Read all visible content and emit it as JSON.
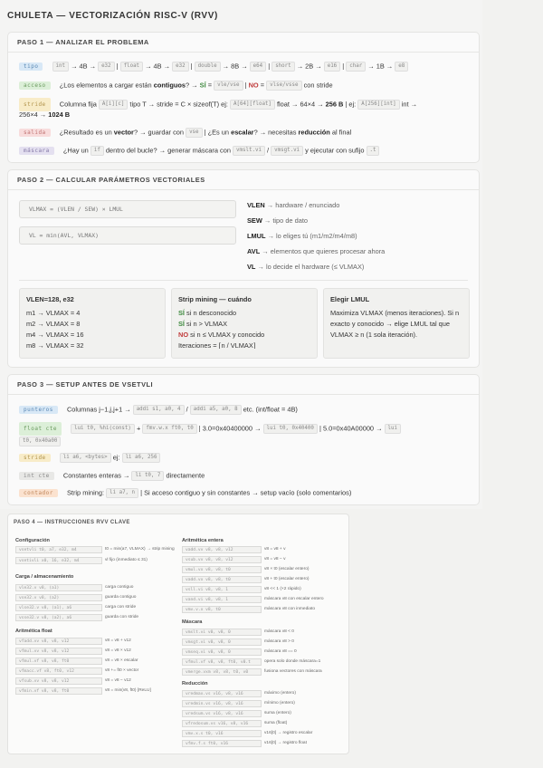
{
  "title": "CHULETA — VECTORIZACIÓN RISC-V (RVV)",
  "paso1": {
    "header": "PASO 1 — ANALIZAR EL PROBLEMA",
    "tipo_tag": "tipo",
    "tipo": {
      "c1": "int",
      "t1": "→ 4B →",
      "c2": "e32",
      "sep1": "|",
      "c3": "float",
      "t2": "→ 4B →",
      "c4": "e32",
      "sep2": "|",
      "c5": "double",
      "t3": "→ 8B →",
      "c6": "e64",
      "sep3": "|",
      "c7": "short",
      "t4": "→ 2B →",
      "c8": "e16",
      "sep4": "|",
      "c9": "char",
      "t5": "→ 1B →",
      "c10": "e8"
    },
    "acceso_tag": "acceso",
    "acceso": {
      "q": "¿Los elementos a cargar están",
      "b1": "contiguos",
      "q2": "? →",
      "si": "SÍ",
      "eq1": "=",
      "c1": "vle/vse",
      "sep": "|",
      "no": "NO",
      "eq2": "=",
      "c2": "vlse/vsse",
      "tail": "con stride"
    },
    "stride_tag": "stride",
    "stride": {
      "t1": "Columna fija",
      "c1": "A[i][c]",
      "t2": "tipo T → stride = C × sizeof(T)   ej:",
      "c2": "A[64][float]",
      "t3": "float → 64×4 →",
      "b1": "256 B",
      "sep": "|",
      "t4": "ej:",
      "c3": "A[256][int]",
      "t5": "int →",
      "line2": "256×4 →",
      "b2": "1024 B"
    },
    "salida_tag": "salida",
    "salida": {
      "t1": "¿Resultado es un",
      "b1": "vector",
      "t2": "? → guardar con",
      "c1": "vse",
      "sep": "|",
      "t3": "¿Es un",
      "b2": "escalar",
      "t4": "? → necesitas",
      "b3": "reducción",
      "t5": "al final"
    },
    "mascara_tag": "máscara",
    "mascara": {
      "t1": "¿Hay un",
      "c1": "if",
      "t2": "dentro del bucle? → generar máscara con",
      "c2": "vmslt.vi",
      "t3": "/",
      "c3": "vmsgt.vi",
      "t4": "y ejecutar con sufijo",
      "c4": ".t"
    }
  },
  "paso2": {
    "header": "PASO 2 — CALCULAR PARÁMETROS VECTORIALES",
    "f1": "VLMAX = (VLEN / SEW) × LMUL",
    "f2": "VL = min(AVL, VLMAX)",
    "defs": [
      {
        "k": "VLEN",
        "v": "→ hardware / enunciado"
      },
      {
        "k": "SEW",
        "v": "→ tipo de dato"
      },
      {
        "k": "LMUL",
        "v": "→ lo eliges tú (m1/m2/m4/m8)"
      },
      {
        "k": "AVL",
        "v": "→ elementos que quieres procesar ahora"
      },
      {
        "k": "VL",
        "v": "→ lo decide el hardware (≤ VLMAX)"
      }
    ],
    "box1": {
      "h": "VLEN=128, e32",
      "lines": [
        "m1 → VLMAX = 4",
        "m2 → VLMAX = 8",
        "m4 → VLMAX = 16",
        "m8 → VLMAX = 32"
      ]
    },
    "box2": {
      "h": "Strip mining — cuándo",
      "l1a": "SÍ",
      "l1b": "si n desconocido",
      "l2a": "SÍ",
      "l2b": "si n > VLMAX",
      "l3a": "NO",
      "l3b": "si n ≤ VLMAX y conocido",
      "l4": "Iteraciones = ⌈n / VLMAX⌉"
    },
    "box3": {
      "h": "Elegir LMUL",
      "text": "Maximiza VLMAX (menos iteraciones). Si n exacto y conocido → elige LMUL tal que VLMAX ≥ n (1 sola iteración)."
    }
  },
  "paso3": {
    "header": "PASO 3 — SETUP ANTES DE VSETVLI",
    "punteros_tag": "punteros",
    "punteros": {
      "t1": "Columnas j−1,j,j+1 →",
      "c1": "addi s1, a0, 4",
      "t2": "/",
      "c2": "addi a5, a0, 8",
      "t3": "etc. (int/float = 4B)"
    },
    "floats_tag": "float cte",
    "floats": {
      "c1": "lui t0, %hi(const)",
      "t1": "+",
      "c2": "fmv.w.x ft0, t0",
      "t2": "| 3.0=0x40400000 →",
      "c3": "lui t0, 0x40400",
      "t3": "| 5.0=0x40A00000 →",
      "c4": "lui",
      "c5": "t0, 0x40a00"
    },
    "stride_tag": "stride",
    "stride": {
      "c1": "li a6, <bytes>",
      "t1": "ej:",
      "c2": "li a6, 256"
    },
    "int_tag": "int cte",
    "int": {
      "t1": "Constantes enteras →",
      "c1": "li t0, 7",
      "t2": "directamente"
    },
    "contador_tag": "contador",
    "contador": {
      "t1": "Strip mining:",
      "c1": "li a7, n",
      "t2": "| Si acceso contiguo y sin constantes → setup vacío (solo comentarios)"
    }
  },
  "paso4": {
    "header": "PASO 4 — INSTRUCCIONES RVV CLAVE",
    "config_h": "Configuración",
    "config": [
      {
        "c": "vsetvli t0, a7, e32, m4",
        "d": "t0 = min(a7, VLMAX) → strip mining"
      },
      {
        "c": "vsetivli x0, 16, e32, m4",
        "d": "vl fijo (inmediato ≤ 31)"
      }
    ],
    "carga_h": "Carga / almacenamiento",
    "carga": [
      {
        "c": "vle32.v v8, (a1)",
        "d": "carga contiguo"
      },
      {
        "c": "vse32.v v8, (a2)",
        "d": "guarda contiguo"
      },
      {
        "c": "vlse32.v v8, (a1), a6",
        "d": "carga con stride"
      },
      {
        "c": "vsse32.v v8, (a2), a6",
        "d": "guarda con stride"
      }
    ],
    "afloat_h": "Aritmética float",
    "afloat": [
      {
        "c": "vfadd.vv v8, v8, v12",
        "d": "v8 = v8 + v12"
      },
      {
        "c": "vfmul.vv v8, v8, v12",
        "d": "v8 = v8 × v12"
      },
      {
        "c": "vfmul.vf v8, v8, ft0",
        "d": "v8 = v8 × escalar"
      },
      {
        "c": "vfmacc.vf v8, ft0, v12",
        "d": "v8 += ft0 × vector"
      },
      {
        "c": "vfsub.vv v8, v8, v12",
        "d": "v8 = v8 − v12"
      },
      {
        "c": "vfmin.vf v8, v8, ft0",
        "d": "v8 = min(v8, ft0) [ReLU]"
      }
    ],
    "aentera_h": "Aritmética entera",
    "aentera": [
      {
        "c": "vadd.vv v8, v8, v12",
        "d": "v8 = v8 + v"
      },
      {
        "c": "vsub.vv v8, v8, v12",
        "d": "v8 = v8 − v"
      },
      {
        "c": "vmul.vx v8, v8, t0",
        "d": "v8 × t0 (escalar entero)"
      },
      {
        "c": "vadd.vx v8, v8, t0",
        "d": "v8 + t0 (escalar entero)"
      },
      {
        "c": "vsll.vi v8, v8, 1",
        "d": "v8 << 1 (×2 rápido)"
      },
      {
        "c": "vand.vi v8, v8, 1",
        "d": "máscara v8 con escalar entero"
      },
      {
        "c": "vmv.v.x v8, t0",
        "d": "máscara v8 con inmediato"
      }
    ],
    "mascara_h": "Máscara",
    "mascara": [
      {
        "c": "vmslt.vi v0, v8, 0",
        "d": "máscara v8 < 0"
      },
      {
        "c": "vmsgt.vi v0, v8, 0",
        "d": "máscara v8 > 0"
      },
      {
        "c": "vmseq.vi v0, v8, 0",
        "d": "máscara v8 == 0"
      },
      {
        "c": "vfmul.vf v8, v8, ft0, v0.t",
        "d": "opera solo donde máscara=1"
      },
      {
        "c": "vmerge.vxm v8, v8, t0, v0",
        "d": "fusiona vectores con máscara"
      }
    ],
    "reduccion_h": "Reducción",
    "reduccion": [
      {
        "c": "vredmax.vs v16, v8, v16",
        "d": "máximo (entero)"
      },
      {
        "c": "vredmin.vs v16, v8, v16",
        "d": "mínimo (entero)"
      },
      {
        "c": "vredsum.vs v16, v8, v16",
        "d": "suma (entero)"
      },
      {
        "c": "vfredosum.vs v16, v8, v16",
        "d": "suma (float)"
      },
      {
        "c": "vmv.x.s t0, v16",
        "d": "v16[0] → registro escalar"
      },
      {
        "c": "vfmv.f.s ft0, v16",
        "d": "v16[0] → registro float"
      }
    ]
  }
}
